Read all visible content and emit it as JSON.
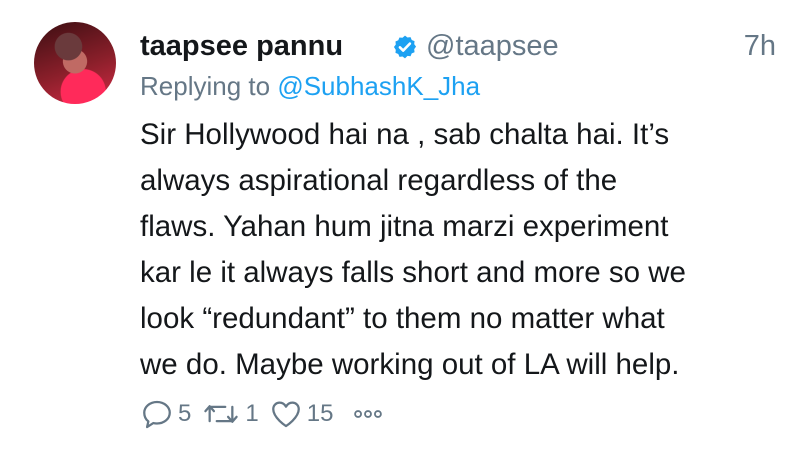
{
  "tweet": {
    "display_name": "taapsee pannu",
    "handle": "@taapsee",
    "timestamp": "7h",
    "replying_prefix": "Replying to ",
    "replying_to": "@SubhashK_Jha",
    "text_lines": [
      "Sir Hollywood hai na , sab chalta hai. It’s",
      "always aspirational regardless of the",
      "flaws. Yahan hum jitna marzi experiment",
      "kar le it always falls short and more so we",
      "look “redundant” to them no matter what",
      "we do. Maybe working out of LA will help."
    ]
  },
  "actions": {
    "replies": "5",
    "retweets": "1",
    "likes": "15"
  },
  "icons": {
    "verified": "verified-badge-icon",
    "reply": "reply-icon",
    "retweet": "retweet-icon",
    "like": "heart-icon",
    "more": "more-options-icon"
  },
  "colors": {
    "text": "#14171a",
    "muted": "#657786",
    "accent": "#1da1f2"
  }
}
